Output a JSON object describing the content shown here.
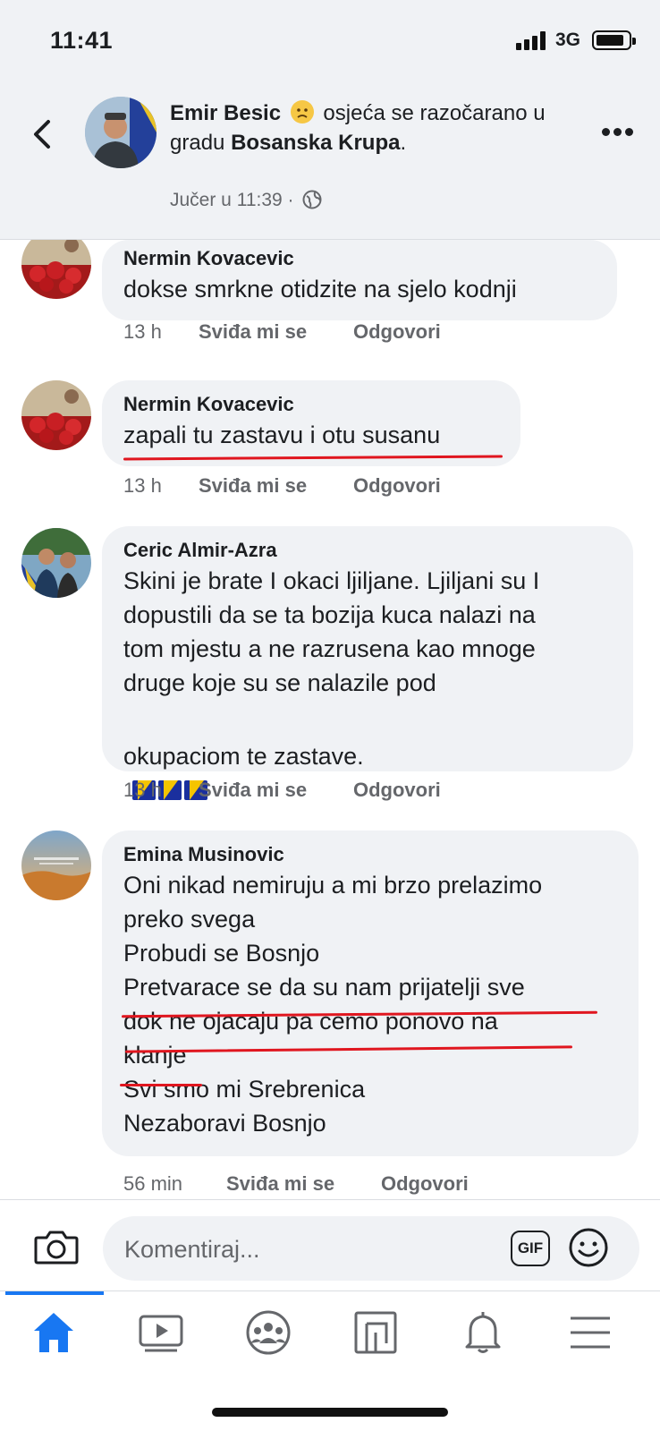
{
  "status_bar": {
    "time": "11:41",
    "network": "3G"
  },
  "post": {
    "author": "Emir Besic",
    "feeling": "osjeća se razočarano u gradu",
    "place": "Bosanska Krupa",
    "meta": "Jučer u 11:39 ·"
  },
  "comments": [
    {
      "author": "Nermin Kovacevic",
      "text": "dokse smrkne otidzite na sjelo kodnji",
      "time": "13 h",
      "like": "Sviđa mi se",
      "reply": "Odgovori"
    },
    {
      "author": "Nermin Kovacevic",
      "text": "zapali tu zastavu i otu susanu",
      "time": "13 h",
      "like": "Sviđa mi se",
      "reply": "Odgovori"
    },
    {
      "author": "Ceric Almir-Azra",
      "text": "Skini je brate I okaci ljiljane. Ljiljani su I\ndopustili da se ta bozija kuca nalazi na\ntom mjestu a ne razrusena kao mnoge\ndruge koje su se nalazile pod",
      "text_end": "okupaciom te zastave.",
      "time": "13 h",
      "like": "Sviđa mi se",
      "reply": "Odgovori"
    },
    {
      "author": "Emina Musinovic",
      "text": "Oni nikad nemiruju a mi brzo prelazimo\npreko svega\nProbudi se Bosnjo\nPretvarace se da su nam prijatelji sve\ndok ne ojacaju pa cemo ponovo na\nklanje\nSvi smo mi Srebrenica\nNezaboravi Bosnjo",
      "time": "56 min",
      "like": "Sviđa mi se",
      "reply": "Odgovori"
    }
  ],
  "composer": {
    "placeholder": "Komentiraj...",
    "gif_label": "GIF"
  },
  "colors": {
    "accent": "#1877f2",
    "underline": "#e0161f",
    "bubble": "#f0f2f5"
  },
  "icons": [
    "back-icon",
    "more-icon",
    "globe-icon",
    "camera-icon",
    "gif-icon",
    "emoji-icon",
    "home-icon",
    "watch-icon",
    "groups-icon",
    "pages-icon",
    "bell-icon",
    "menu-icon"
  ]
}
